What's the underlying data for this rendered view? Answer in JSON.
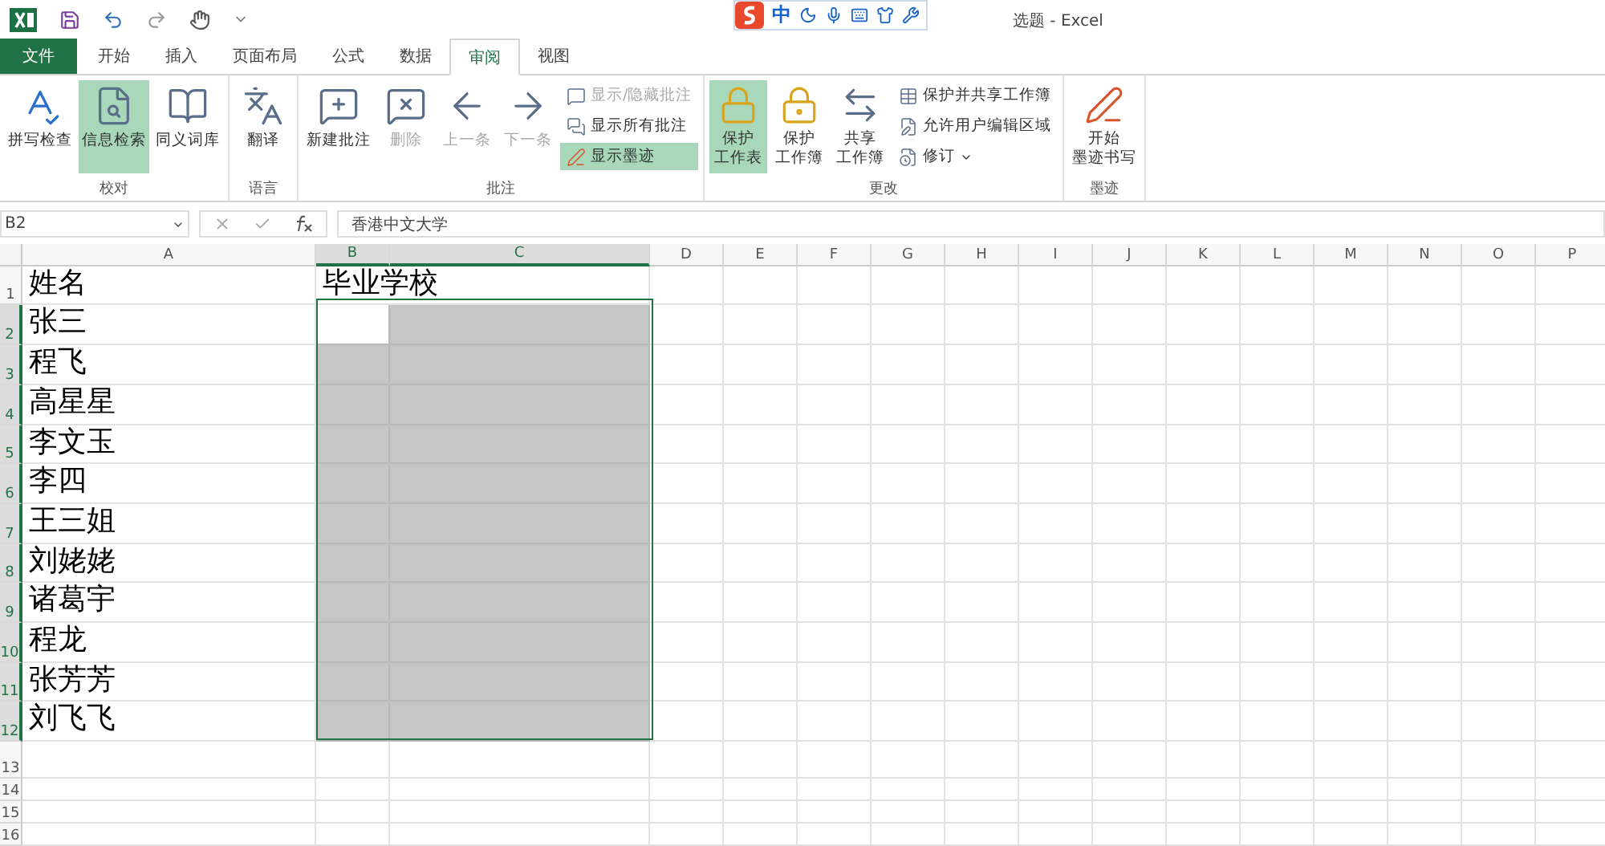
{
  "window": {
    "title": "选题 - Excel"
  },
  "ime_bar": {
    "mode": "中"
  },
  "tabs": [
    {
      "label": "文件",
      "kind": "file",
      "selected": false
    },
    {
      "label": "开始",
      "kind": "tab",
      "selected": false
    },
    {
      "label": "插入",
      "kind": "tab",
      "selected": false
    },
    {
      "label": "页面布局",
      "kind": "tab",
      "selected": false
    },
    {
      "label": "公式",
      "kind": "tab",
      "selected": false
    },
    {
      "label": "数据",
      "kind": "tab",
      "selected": false
    },
    {
      "label": "审阅",
      "kind": "tab",
      "selected": true
    },
    {
      "label": "视图",
      "kind": "tab",
      "selected": false
    }
  ],
  "ribbon_groups": [
    {
      "label": "校对",
      "items": [
        {
          "kind": "large",
          "label": "拼写检查",
          "active": false,
          "disabled": false
        },
        {
          "kind": "large",
          "label": "信息检索",
          "active": true,
          "disabled": false
        },
        {
          "kind": "large",
          "label": "同义词库",
          "active": false,
          "disabled": false
        }
      ]
    },
    {
      "label": "语言",
      "items": [
        {
          "kind": "large",
          "label": "翻译",
          "active": false,
          "disabled": false
        }
      ]
    },
    {
      "label": "批注",
      "items": [
        {
          "kind": "large",
          "label": "新建批注",
          "active": false,
          "disabled": false
        },
        {
          "kind": "large",
          "label": "删除",
          "active": false,
          "disabled": true
        },
        {
          "kind": "large",
          "label": "上一条",
          "active": false,
          "disabled": true
        },
        {
          "kind": "large",
          "label": "下一条",
          "active": false,
          "disabled": true
        },
        {
          "kind": "stack",
          "items": [
            {
              "label": "显示/隐藏批注",
              "active": false,
              "disabled": true
            },
            {
              "label": "显示所有批注",
              "active": false,
              "disabled": false
            },
            {
              "label": "显示墨迹",
              "active": true,
              "disabled": false
            }
          ]
        }
      ]
    },
    {
      "label": "更改",
      "items": [
        {
          "kind": "large",
          "label": "保护工作表",
          "active": true,
          "disabled": false
        },
        {
          "kind": "large",
          "label": "保护工作簿",
          "active": false,
          "disabled": false
        },
        {
          "kind": "large",
          "label": "共享工作簿",
          "active": false,
          "disabled": false
        },
        {
          "kind": "stack",
          "items": [
            {
              "label": "保护并共享工作簿",
              "active": false,
              "disabled": false
            },
            {
              "label": "允许用户编辑区域",
              "active": false,
              "disabled": false
            },
            {
              "label": "修订",
              "active": false,
              "disabled": false,
              "dropdown": true
            }
          ]
        }
      ]
    },
    {
      "label": "墨迹",
      "items": [
        {
          "kind": "large",
          "label": "开始墨迹书写",
          "active": false,
          "disabled": false
        }
      ]
    }
  ],
  "formula_bar": {
    "name_box": "B2",
    "value": "香港中文大学"
  },
  "columns": [
    {
      "label": "A",
      "selected": false
    },
    {
      "label": "B",
      "selected": true
    },
    {
      "label": "C",
      "selected": true
    },
    {
      "label": "D",
      "selected": false
    },
    {
      "label": "E",
      "selected": false
    },
    {
      "label": "F",
      "selected": false
    },
    {
      "label": "G",
      "selected": false
    },
    {
      "label": "H",
      "selected": false
    },
    {
      "label": "I",
      "selected": false
    },
    {
      "label": "J",
      "selected": false
    },
    {
      "label": "K",
      "selected": false
    },
    {
      "label": "L",
      "selected": false
    },
    {
      "label": "M",
      "selected": false
    },
    {
      "label": "N",
      "selected": false
    },
    {
      "label": "O",
      "selected": false
    },
    {
      "label": "P",
      "selected": false
    }
  ],
  "rows": [
    {
      "header": "1",
      "selected": false,
      "cells": [
        {
          "text": "姓名",
          "selected": false
        },
        {
          "text": "毕业学校",
          "selected": false
        },
        {
          "selected": false
        }
      ]
    },
    {
      "header": "2",
      "selected": true,
      "cells": [
        {
          "text": "张三",
          "selected": false
        },
        {
          "selected": true,
          "active": true
        },
        {
          "selected": true
        }
      ]
    },
    {
      "header": "3",
      "selected": true,
      "cells": [
        {
          "text": "程飞",
          "selected": false
        },
        {
          "selected": true
        },
        {
          "selected": true
        }
      ]
    },
    {
      "header": "4",
      "selected": true,
      "cells": [
        {
          "text": "高星星",
          "selected": false
        },
        {
          "selected": true
        },
        {
          "selected": true
        }
      ]
    },
    {
      "header": "5",
      "selected": true,
      "cells": [
        {
          "text": "李文玉",
          "selected": false
        },
        {
          "selected": true
        },
        {
          "selected": true
        }
      ]
    },
    {
      "header": "6",
      "selected": true,
      "cells": [
        {
          "text": "李四",
          "selected": false
        },
        {
          "selected": true
        },
        {
          "selected": true
        }
      ]
    },
    {
      "header": "7",
      "selected": true,
      "cells": [
        {
          "text": "王三姐",
          "selected": false
        },
        {
          "selected": true
        },
        {
          "selected": true
        }
      ]
    },
    {
      "header": "8",
      "selected": true,
      "cells": [
        {
          "text": "刘姥姥",
          "selected": false
        },
        {
          "selected": true
        },
        {
          "selected": true
        }
      ]
    },
    {
      "header": "9",
      "selected": true,
      "cells": [
        {
          "text": "诸葛宇",
          "selected": false
        },
        {
          "selected": true
        },
        {
          "selected": true
        }
      ]
    },
    {
      "header": "10",
      "selected": true,
      "cells": [
        {
          "text": "程龙",
          "selected": false
        },
        {
          "selected": true
        },
        {
          "selected": true
        }
      ]
    },
    {
      "header": "11",
      "selected": true,
      "cells": [
        {
          "text": "张芳芳",
          "selected": false
        },
        {
          "selected": true
        },
        {
          "selected": true
        }
      ]
    },
    {
      "header": "12",
      "selected": true,
      "cells": [
        {
          "text": "刘飞飞",
          "selected": false
        },
        {
          "selected": true
        },
        {
          "selected": true
        }
      ]
    },
    {
      "header": "13",
      "selected": false,
      "cells": [
        {
          "selected": false
        },
        {
          "selected": false
        },
        {
          "selected": false
        }
      ]
    },
    {
      "header": "14",
      "selected": false,
      "cells": [
        {
          "selected": false
        },
        {
          "selected": false
        },
        {
          "selected": false
        }
      ]
    },
    {
      "header": "15",
      "selected": false,
      "cells": [
        {
          "selected": false
        },
        {
          "selected": false
        },
        {
          "selected": false
        }
      ]
    },
    {
      "header": "16",
      "selected": false,
      "cells": [
        {
          "selected": false
        },
        {
          "selected": false
        },
        {
          "selected": false
        }
      ]
    }
  ]
}
